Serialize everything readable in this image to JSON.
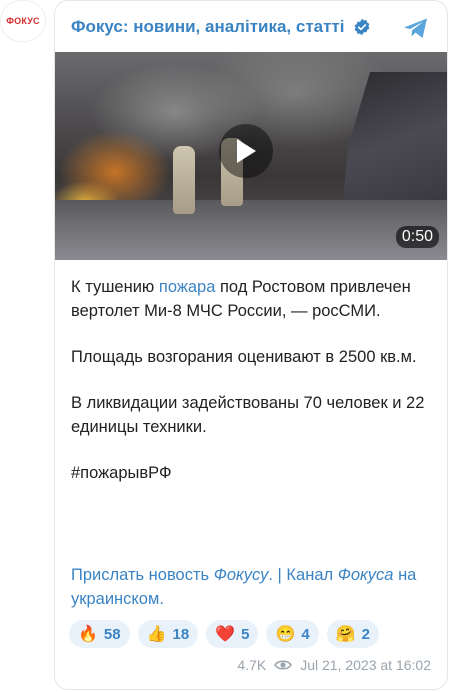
{
  "avatar": {
    "text": "ФОКУС"
  },
  "header": {
    "channel_title": "Фокус: новини, аналітика, статті"
  },
  "video": {
    "duration": "0:50"
  },
  "post": {
    "line1_before": "К тушению ",
    "line1_link": "пожара",
    "line1_after": " под Ростовом привлечен вертолет Ми-8 МЧС России, — росСМИ.",
    "para2": "Площадь возгорания оценивают в 2500 кв.м.",
    "para3": "В ликвидации задействованы 70 человек и 22 единицы техники.",
    "hashtag": "#пожарывРФ"
  },
  "footer_links": {
    "part1": "Прислать новость ",
    "part1_italic": "Фокусу",
    "sep": ". | ",
    "part2": "Канал ",
    "part2_italic": "Фокуса",
    "part2_end": " на украинском."
  },
  "reactions": [
    {
      "emoji": "🔥",
      "count": "58"
    },
    {
      "emoji": "👍",
      "count": "18"
    },
    {
      "emoji": "❤️",
      "count": "5"
    },
    {
      "emoji": "😁",
      "count": "4"
    },
    {
      "emoji": "🤗",
      "count": "2"
    }
  ],
  "meta": {
    "views": "4.7K",
    "timestamp": "Jul 21, 2023 at 16:02"
  },
  "colors": {
    "accent": "#3b84c4",
    "reaction_bg": "#e9f2fb",
    "meta": "#9aa4ad"
  },
  "icons": [
    "verified-icon",
    "telegram-icon",
    "play-icon",
    "eye-icon"
  ]
}
